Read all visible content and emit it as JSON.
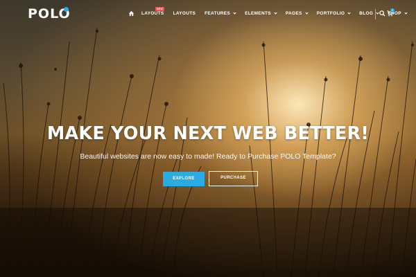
{
  "brand": {
    "logo": "POLO",
    "accent": "#2aace3"
  },
  "nav": {
    "home_icon": "home-icon",
    "items": [
      {
        "label": "LAYOUTS",
        "badge": "NEW",
        "caret": false
      },
      {
        "label": "LAYOUTS",
        "caret": false
      },
      {
        "label": "FEATURES",
        "caret": true
      },
      {
        "label": "ELEMENTS",
        "caret": true
      },
      {
        "label": "PAGES",
        "caret": true
      },
      {
        "label": "PORTFOLIO",
        "caret": true
      },
      {
        "label": "BLOG",
        "caret": true
      },
      {
        "label": "SHOP",
        "caret": true
      }
    ],
    "search_icon": "search-icon",
    "cart_icon": "cart-icon",
    "cart_count": "0"
  },
  "hero": {
    "headline": "MAKE YOUR NEXT WEB BETTER!",
    "subline": "Beautiful websites are now easy to made! Ready to Purchase POLO Template?",
    "primary_button": "EXPLORE",
    "secondary_button": "PURCHASE"
  },
  "colors": {
    "primary_button": "#2aace3",
    "badge": "#e8505b"
  }
}
